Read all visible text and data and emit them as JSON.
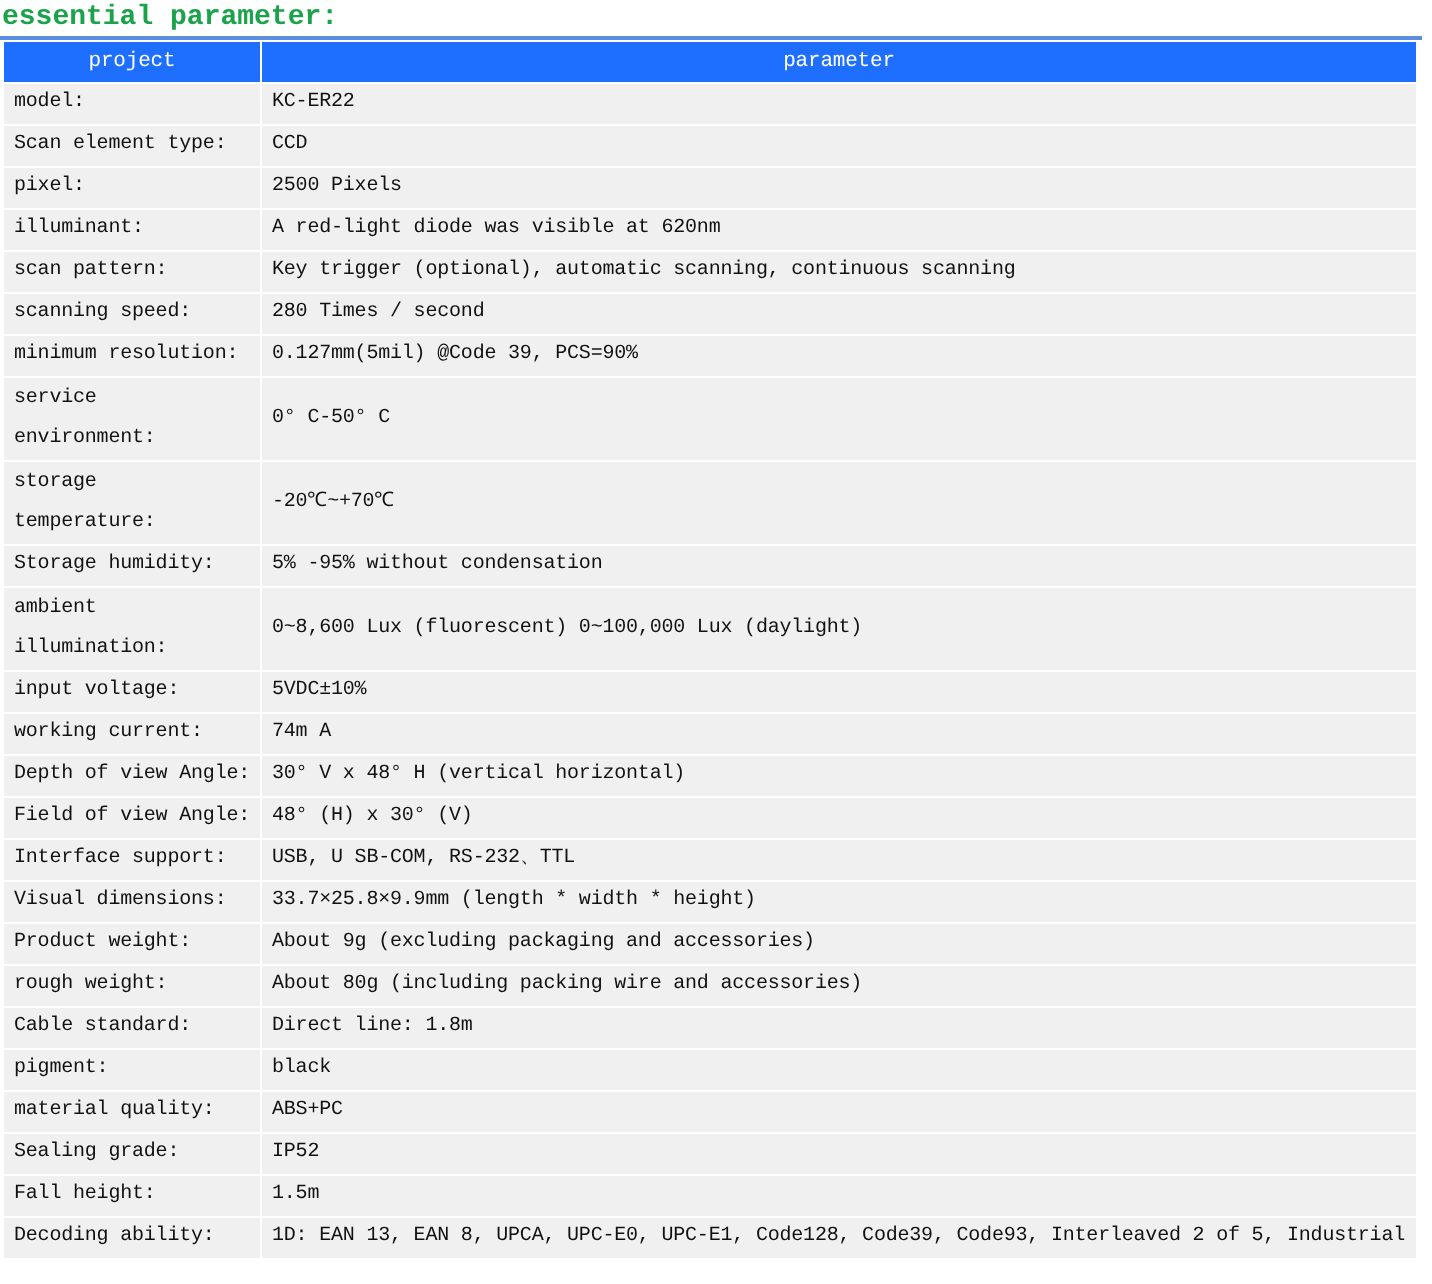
{
  "title": "essential parameter:",
  "columns": [
    "project",
    "parameter"
  ],
  "rows": [
    {
      "label": "model:",
      "value": "KC-ER22"
    },
    {
      "label": "Scan element type:",
      "value": "CCD"
    },
    {
      "label": "pixel:",
      "value": "2500 Pixels"
    },
    {
      "label": "illuminant:",
      "value": "A red-light diode was visible at 620nm"
    },
    {
      "label": "scan pattern:",
      "value": "Key trigger (optional), automatic scanning, continuous scanning"
    },
    {
      "label": "scanning speed:",
      "value": "280 Times / second"
    },
    {
      "label": "minimum resolution:",
      "value": "0.127mm(5mil) @Code 39, PCS=90%"
    },
    {
      "label": "service\nenvironment:",
      "value": "0° C-50° C"
    },
    {
      "label": "storage\ntemperature:",
      "value": "-20℃~+70℃"
    },
    {
      "label": "Storage humidity:",
      "value": "5% -95% without condensation"
    },
    {
      "label": "ambient\nillumination:",
      "value": "0~8,600 Lux (fluorescent) 0~100,000 Lux (daylight)"
    },
    {
      "label": "input voltage:",
      "value": "5VDC±10%"
    },
    {
      "label": "working current:",
      "value": "74m A"
    },
    {
      "label": "Depth of view Angle:",
      "value": "30°  V x 48°  H (vertical horizontal)"
    },
    {
      "label": "Field of view Angle:",
      "value": "48°  (H) x 30°  (V)"
    },
    {
      "label": "Interface support:",
      "value": "USB, U SB-COM, RS-232、TTL"
    },
    {
      "label": "Visual dimensions:",
      "value": "33.7×25.8×9.9mm (length * width * height)"
    },
    {
      "label": "Product weight:",
      "value": "About 9g (excluding packaging and accessories)"
    },
    {
      "label": "rough weight:",
      "value": "About 80g (including packing wire and accessories)"
    },
    {
      "label": "Cable standard:",
      "value": "Direct line: 1.8m"
    },
    {
      "label": "pigment:",
      "value": "black"
    },
    {
      "label": "material quality:",
      "value": "ABS+PC"
    },
    {
      "label": "Sealing grade:",
      "value": "IP52"
    },
    {
      "label": "Fall height:",
      "value": "1.5m"
    },
    {
      "label": "Decoding ability:",
      "value": "1D: EAN 13, EAN 8, UPCA, UPC-E0, UPC-E1, Code128, Code39, Code93, Interleaved 2 of 5, Industrial"
    }
  ]
}
